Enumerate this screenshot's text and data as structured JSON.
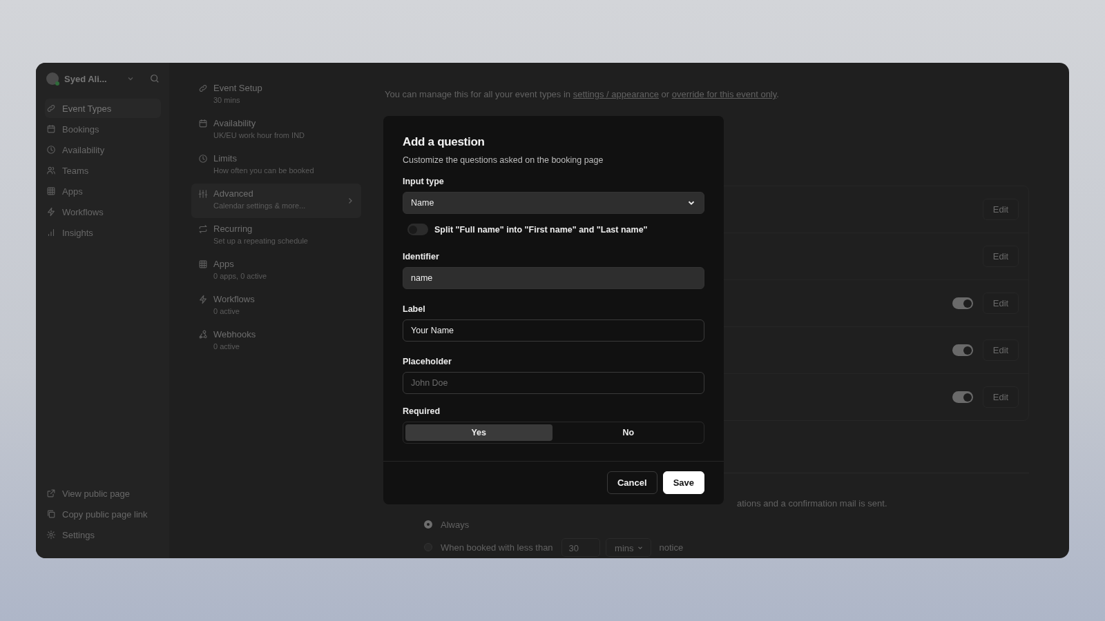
{
  "sidebar": {
    "user": {
      "name": "Syed Ali..."
    },
    "items": [
      {
        "label": "Event Types",
        "selected": true
      },
      {
        "label": "Bookings",
        "selected": false
      },
      {
        "label": "Availability",
        "selected": false
      },
      {
        "label": "Teams",
        "selected": false
      },
      {
        "label": "Apps",
        "selected": false
      },
      {
        "label": "Workflows",
        "selected": false
      },
      {
        "label": "Insights",
        "selected": false
      }
    ],
    "footer_items": [
      {
        "label": "View public page"
      },
      {
        "label": "Copy public page link"
      },
      {
        "label": "Settings"
      }
    ]
  },
  "event_nav": {
    "items": [
      {
        "title": "Event Setup",
        "subtitle": "30 mins",
        "selected": false
      },
      {
        "title": "Availability",
        "subtitle": "UK/EU work hour from IND",
        "selected": false
      },
      {
        "title": "Limits",
        "subtitle": "How often you can be booked",
        "selected": false
      },
      {
        "title": "Advanced",
        "subtitle": "Calendar settings & more...",
        "selected": true
      },
      {
        "title": "Recurring",
        "subtitle": "Set up a repeating schedule",
        "selected": false
      },
      {
        "title": "Apps",
        "subtitle": "0 apps, 0 active",
        "selected": false
      },
      {
        "title": "Workflows",
        "subtitle": "0 active",
        "selected": false
      },
      {
        "title": "Webhooks",
        "subtitle": "0 active",
        "selected": false
      }
    ]
  },
  "main": {
    "notice": {
      "before": "You can manage this for all your event types in",
      "link_1": "settings / appearance",
      "between": "or",
      "link_2": "override for this event only",
      "after": "."
    },
    "question_rows": [
      {
        "kind": "plain",
        "edit": "Edit"
      },
      {
        "kind": "plain",
        "edit": "Edit"
      },
      {
        "kind": "toggle",
        "on": true,
        "edit": "Edit"
      },
      {
        "kind": "toggle",
        "on": true,
        "edit": "Edit"
      },
      {
        "kind": "toggle",
        "on": true,
        "edit": "Edit"
      }
    ],
    "confirmation": {
      "text": "ations and a confirmation mail is sent.",
      "options": [
        {
          "label": "Always",
          "selected": true
        },
        {
          "label": "When booked with less than",
          "selected": false,
          "amount": "30",
          "unit": "mins",
          "suffix": "notice"
        }
      ]
    }
  },
  "modal": {
    "title": "Add a question",
    "subtitle": "Customize the questions asked on the booking page",
    "input_type": {
      "label": "Input type",
      "value": "Name"
    },
    "split_toggle": {
      "label": "Split \"Full name\" into \"First name\" and \"Last name\"",
      "on": false
    },
    "identifier": {
      "label": "Identifier",
      "value": "name"
    },
    "label_field": {
      "label": "Label",
      "value": "Your Name"
    },
    "placeholder_field": {
      "label": "Placeholder",
      "placeholder": "John Doe"
    },
    "required": {
      "label": "Required",
      "options": [
        {
          "label": "Yes",
          "selected": true
        },
        {
          "label": "No",
          "selected": false
        }
      ]
    },
    "buttons": [
      {
        "label": "Cancel",
        "kind": "secondary"
      },
      {
        "label": "Save",
        "kind": "primary"
      }
    ]
  }
}
